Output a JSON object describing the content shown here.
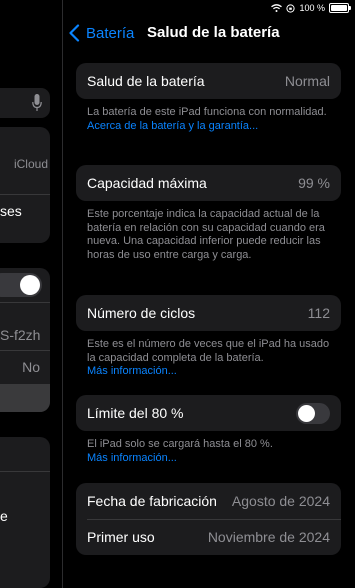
{
  "status_bar": {
    "battery_text": "100 %"
  },
  "nav": {
    "back_label": "Batería",
    "title": "Salud de la batería"
  },
  "sidebar": {
    "icloud_label": "iCloud",
    "item_partial_1": "ses",
    "item_partial_2": "S-f2zh",
    "item_partial_value": "No",
    "item_partial_3": "e"
  },
  "health": {
    "label": "Salud de la batería",
    "value": "Normal",
    "note_text": "La batería de este iPad funciona con normalidad. ",
    "note_link": "Acerca de la batería y la garantía..."
  },
  "capacity": {
    "label": "Capacidad máxima",
    "value": "99 %",
    "note_text": "Este porcentaje indica la capacidad actual de la batería en relación con su capacidad cuando era nueva. Una capacidad inferior puede reducir las horas de uso entre carga y carga."
  },
  "cycles": {
    "label": "Número de ciclos",
    "value": "112",
    "note_text": "Este es el número de veces que el iPad ha usado la capacidad completa de la batería.",
    "note_link": "Más información..."
  },
  "limit": {
    "label": "Límite del 80 %",
    "enabled": false,
    "note_text": "El iPad solo se cargará hasta el 80 %.",
    "note_link": "Más información..."
  },
  "dates": {
    "manufacture_label": "Fecha de fabricación",
    "manufacture_value": "Agosto de 2024",
    "first_use_label": "Primer uso",
    "first_use_value": "Noviembre de 2024"
  }
}
